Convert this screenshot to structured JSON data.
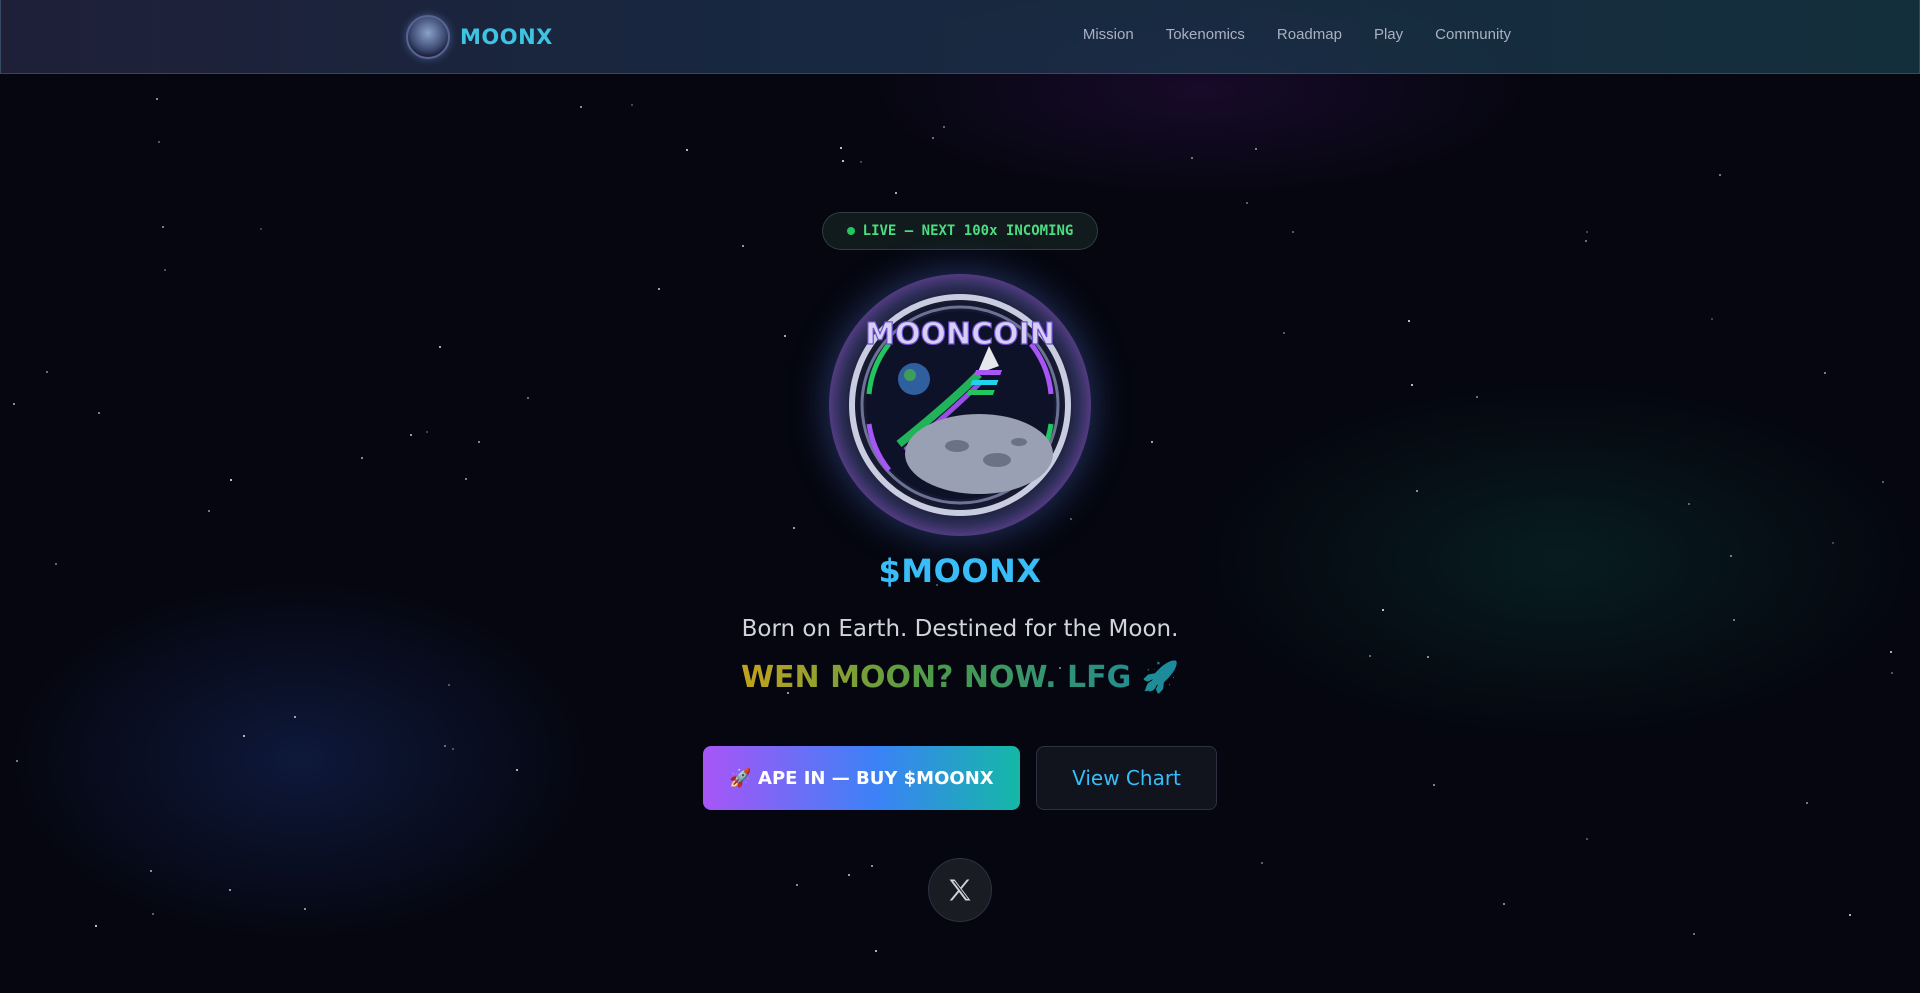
{
  "nav": {
    "brand": "MOONX",
    "links": [
      "Mission",
      "Tokenomics",
      "Roadmap",
      "Play",
      "Community"
    ]
  },
  "hero": {
    "live_badge": "LIVE — NEXT 100x INCOMING",
    "coin_text": "MOONCOIN",
    "ticker": "$MOONX",
    "tagline": "Born on Earth. Destined for the Moon.",
    "slogan": "WEN MOON? NOW. LFG 🚀",
    "buy_button": "🚀 APE IN — BUY $MOONX",
    "chart_button": "View Chart",
    "social_icon": "x-logo-icon"
  },
  "colors": {
    "brand": "#3ec3e0",
    "live": "#4ade80",
    "ticker": "#38bdf8",
    "background": "#05060f"
  }
}
